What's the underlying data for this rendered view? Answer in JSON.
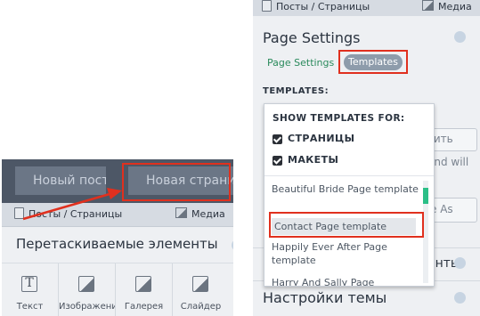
{
  "left_panel": {
    "buttons": [
      "Новый пост",
      "Новая страница"
    ],
    "sub_nav": [
      {
        "label": "Посты / Страницы",
        "icon": "document-icon"
      },
      {
        "label": "Медиа",
        "icon": "image-icon"
      }
    ],
    "section_title": "Перетаскиваемые элементы",
    "tools": [
      {
        "label": "Текст",
        "icon": "text-icon"
      },
      {
        "label": "Изображения",
        "icon": "image-icon"
      },
      {
        "label": "Галерея",
        "icon": "gallery-icon"
      },
      {
        "label": "Слайдер",
        "icon": "slider-icon"
      }
    ]
  },
  "right_panel": {
    "sub_nav": [
      {
        "label": "Посты / Страницы",
        "icon": "document-icon"
      },
      {
        "label": "Медиа",
        "icon": "image-icon"
      }
    ],
    "title": "Page Settings",
    "tabs": [
      "Page Settings",
      "Templates"
    ],
    "active_tab": "Templates",
    "templates_label": "TEMPLATES:",
    "background_fragments": [
      "нить",
      "and will",
      "e As",
      "енты"
    ],
    "bottom_title": "Настройки темы"
  },
  "dropdown": {
    "header": "SHOW TEMPLATES FOR:",
    "checkboxes": [
      {
        "label": "СТРАНИЦЫ",
        "checked": true
      },
      {
        "label": "МАКЕТЫ",
        "checked": true
      }
    ],
    "items": [
      "Beautiful Bride Page template",
      "Contact Page template",
      "Happily Ever After Page template",
      "Harry And Sally Page"
    ],
    "highlighted": "Contact Page template"
  },
  "colors": {
    "panel_bg": "#eef0f3",
    "topbar": "#4d5766",
    "accent_green": "#2a8a5c",
    "highlight_red": "#e0301e",
    "scroll_thumb": "#2bbf87"
  }
}
